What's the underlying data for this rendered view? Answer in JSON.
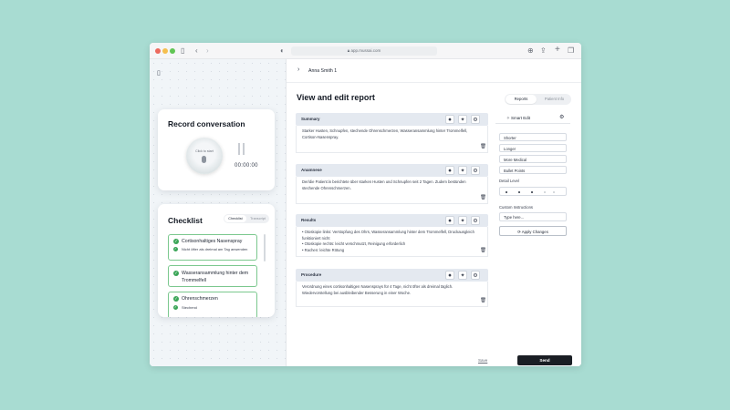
{
  "browser": {
    "url": "app.mussai.com"
  },
  "header": {
    "back": "›",
    "patient_name": "Anna Smith 1"
  },
  "main": {
    "title": "View and edit report",
    "tabs": [
      {
        "label": "Reports"
      },
      {
        "label": "Patient Info"
      }
    ],
    "sections": [
      {
        "label": "Summary",
        "text": "Starker Husten, Schnupfen, stechende Ohrenschmerzen, Wasseransammlung hinter Trommelfell, Cortison-Nasenspray."
      },
      {
        "label": "Anamnese",
        "text": "Der/die Patient:in berichtete über starken Husten und Schnupfen seit 2 Tagen. Zudem bestünden stechende Ohrenschmerzen."
      },
      {
        "label": "Results",
        "bullets": [
          "Otoskopie links: Verstopfung des Ohrs, Wasseransammlung hinter dem Trommelfell, Druckausgleich funktioniert nicht",
          "Otoskopie rechts: leicht verschmutzt, Reinigung erforderlich",
          "Rachen: leichte Rötung"
        ]
      },
      {
        "label": "Procedure",
        "text": "Verordnung eines cortisonhaltigen Nasensprays für 4 Tage, nicht öfter als dreimal täglich. Wiedervorstellung bei ausbleibender Besserung in einer Woche."
      }
    ],
    "save_label": "Save",
    "send_label": "Send"
  },
  "smart_edit": {
    "title": "Smart Edit",
    "options": [
      "Shorter",
      "Longer",
      "More Medical",
      "Bullet Points"
    ],
    "detail_level_label": "Detail Level",
    "detail_level": 3,
    "detail_level_max": 5,
    "custom_label": "Custom Instructions",
    "custom_placeholder": "Type here...",
    "apply_label": "Apply Changes"
  },
  "record": {
    "title": "Record conversation",
    "button_label": "Click to start",
    "timer": "00:00:00"
  },
  "checklist": {
    "title": "Checklist",
    "tabs": [
      "Checklist",
      "Transcript"
    ],
    "items": [
      {
        "title": "Cortisonhaltiges Nasenspray",
        "sub": "Nicht öfter als dreimal am Tag anwenden"
      },
      {
        "title": "Wasseransammlung hinter dem Trommelfell"
      },
      {
        "title": "Ohrenschmerzen",
        "sub": "Stechend"
      }
    ]
  },
  "colors": {
    "accent_green": "#3aa557",
    "send_bg": "#1a1e24",
    "section_head": "#e4e9f0"
  }
}
